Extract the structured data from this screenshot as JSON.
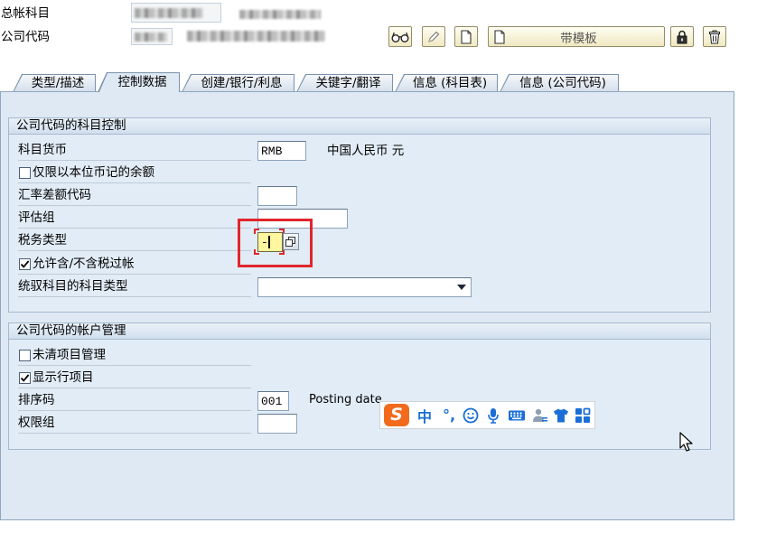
{
  "window": {
    "gl_account_label": "总帐科目",
    "company_code_label": "公司代码"
  },
  "toolbar": {
    "display_change_icon": "glasses-icon",
    "edit_icon": "pencil-icon",
    "create_icon": "document-icon",
    "with_template_label": "带模板",
    "with_template_icon": "document-icon",
    "lock_icon": "lock-icon",
    "delete_icon": "trash-icon"
  },
  "tabs": [
    {
      "label": "类型/描述",
      "active": false
    },
    {
      "label": "控制数据",
      "active": true
    },
    {
      "label": "创建/银行/利息",
      "active": false
    },
    {
      "label": "关键字/翻译",
      "active": false
    },
    {
      "label": "信息 (科目表)",
      "active": false
    },
    {
      "label": "信息 (公司代码)",
      "active": false
    }
  ],
  "account_control": {
    "title": "公司代码的科目控制",
    "currency": {
      "label": "科目货币",
      "value": "RMB",
      "text": "中国人民币 元"
    },
    "local_currency_balances_only": {
      "label": "仅限以本位币记的余额",
      "checked": false
    },
    "exchange_rate_diff_key": {
      "label": "汇率差额代码",
      "value": ""
    },
    "valuation_group": {
      "label": "评估组",
      "value": ""
    },
    "tax_category": {
      "label": "税务类型",
      "value": "-"
    },
    "posting_without_tax_allowed": {
      "label": "允许含/不含税过帐",
      "checked": true
    },
    "recon_account_type": {
      "label": "统驭科目的科目类型",
      "value": ""
    }
  },
  "account_management": {
    "title": "公司代码的帐户管理",
    "open_item_management": {
      "label": "未清项目管理",
      "checked": false
    },
    "line_item_display": {
      "label": "显示行项目",
      "checked": true
    },
    "sort_key": {
      "label": "排序码",
      "value": "001",
      "text": "Posting date"
    },
    "authorization_group": {
      "label": "权限组",
      "value": ""
    }
  },
  "ime_toolbar": {
    "logo_letter": "S",
    "input_mode": "中",
    "punctuation_mode": "°,",
    "icons": [
      "smiley-icon",
      "microphone-icon",
      "keyboard-icon",
      "user-icon",
      "shirt-icon",
      "grid-icon"
    ]
  },
  "colors": {
    "panel_background": "#dfe9f4",
    "annotation_red": "#e0262b",
    "focused_field": "#fff6a0",
    "ime_logo": "#f26b1d",
    "ime_blue": "#1a6fd6"
  }
}
